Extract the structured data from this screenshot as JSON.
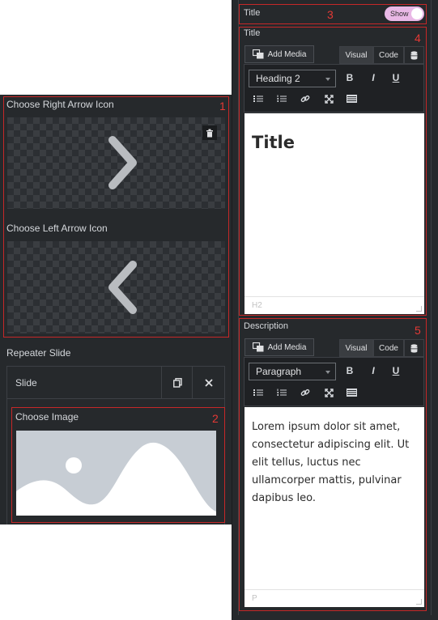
{
  "left": {
    "marker1": "1",
    "right_arrow_label": "Choose Right Arrow Icon",
    "left_arrow_label": "Choose Left Arrow Icon",
    "repeater_label": "Repeater Slide",
    "slide_label": "Slide",
    "marker2": "2",
    "choose_image_label": "Choose Image"
  },
  "right": {
    "marker3": "3",
    "title_toggle_label": "Title",
    "toggle_text": "Show",
    "marker4": "4",
    "title_field_label": "Title",
    "add_media": "Add Media",
    "tab_visual": "Visual",
    "tab_code": "Code",
    "heading_select": "Heading 2",
    "title_content": "Title",
    "title_footer": "H2",
    "marker5": "5",
    "description_label": "Description",
    "paragraph_select": "Paragraph",
    "description_content": "Lorem ipsum dolor sit amet, consectetur adipiscing elit. Ut elit tellus, luctus nec ullamcorper mattis, pulvinar dapibus leo.",
    "description_footer": "P"
  },
  "toolbar": {
    "bold": "B",
    "italic": "I",
    "underline": "U"
  },
  "colors": {
    "panel": "#26292c",
    "marker": "#e53935",
    "toggle_on": "#e9b8e6"
  }
}
